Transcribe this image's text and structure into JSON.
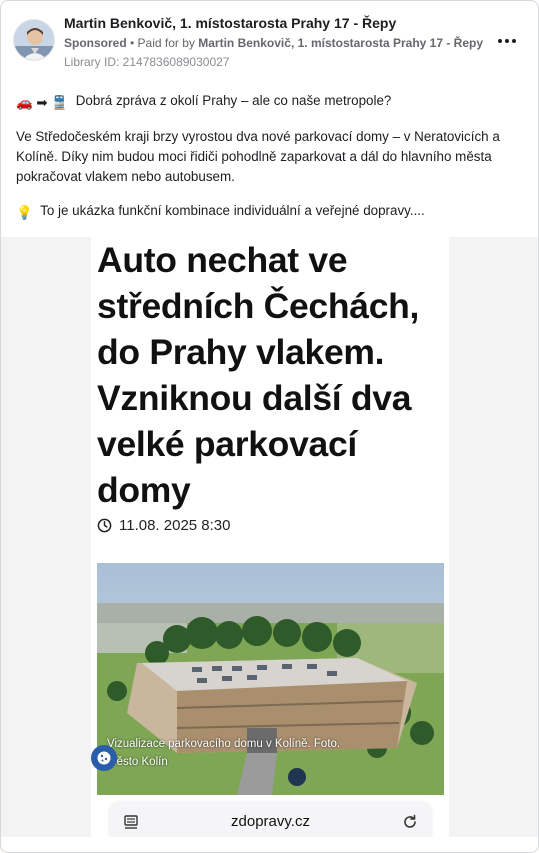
{
  "header": {
    "page_name": "Martin Benkovič, 1. místostarosta Prahy 17 - Řepy",
    "sponsored_label": "Sponsored",
    "paid_for_prefix": " • Paid for by ",
    "paid_for_name": "Martin Benkovič, 1. místostarosta Prahy 17 - Řepy",
    "library_id": "Library ID: 2147836089030027"
  },
  "body": {
    "line1_emojis": "🚗 ➡ 🚆",
    "line1_text": "Dobrá zpráva z okolí Prahy – ale co naše metropole?",
    "paragraph2": "Ve Středočeském kraji brzy vyrostou dva nové parkovací domy – v Neratovicích a Kolíně. Díky nim budou moci řidiči pohodlně zaparkovat a dál do hlavního města pokračovat vlakem nebo autobusem.",
    "line3_emoji": "💡",
    "line3_text": "To je ukázka funkční kombinace individuální a veřejné dopravy...."
  },
  "media": {
    "headline": "Auto nechat ve středních Čechách, do Prahy vlakem. Vzniknou další dva velké parkovací domy",
    "date": "11.08. 2025 8:30",
    "caption": "Vizualizace parkovacího domu v Kolíně. Foto. Město Kolín",
    "url": "zdopravy.cz"
  },
  "icons": {
    "more": "more-horizontal-icon",
    "clock": "clock-icon",
    "cookie": "cookie-icon",
    "menu": "menu-icon",
    "reload": "reload-icon"
  },
  "colors": {
    "text": "#1c1e21",
    "secondary": "#65676b",
    "muted": "#8a8d91",
    "cookie_button": "#2a5ea8"
  }
}
